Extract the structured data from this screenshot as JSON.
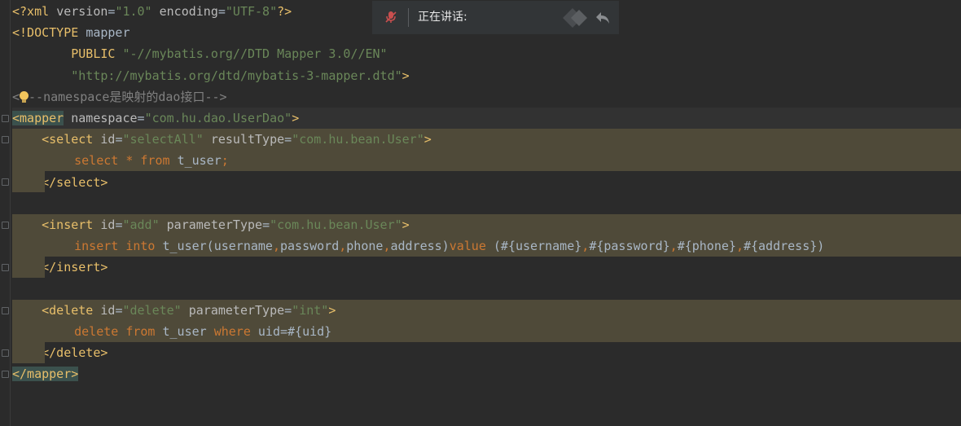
{
  "editor": {
    "lines": [
      {
        "segments": [
          [
            "tag",
            "<?xml "
          ],
          [
            "attr",
            "version"
          ],
          [
            "plain",
            "="
          ],
          [
            "val",
            "\"1.0\""
          ],
          [
            "attr",
            " encoding"
          ],
          [
            "plain",
            "="
          ],
          [
            "val",
            "\"UTF-8\""
          ],
          [
            "tag",
            "?>"
          ]
        ]
      },
      {
        "segments": [
          [
            "tag",
            "<!DOCTYPE "
          ],
          [
            "plain",
            "mapper"
          ]
        ]
      },
      {
        "segments": [
          [
            "plain",
            "        "
          ],
          [
            "tag",
            "PUBLIC "
          ],
          [
            "val",
            "\"-//mybatis.org//DTD Mapper 3.0//EN\""
          ]
        ]
      },
      {
        "segments": [
          [
            "plain",
            "        "
          ],
          [
            "val",
            "\"http://mybatis.org/dtd/mybatis-3-mapper.dtd\""
          ],
          [
            "tag",
            ">"
          ]
        ]
      },
      {
        "segments": [
          [
            "comment",
            "<"
          ],
          [
            "bulb",
            ""
          ],
          [
            "comment",
            "--namespace是映射的dao接口-->"
          ]
        ]
      },
      {
        "segments": [
          [
            "mtag",
            "<mapper"
          ],
          [
            "attr",
            " namespace"
          ],
          [
            "plain",
            "="
          ],
          [
            "val",
            "\"com.hu.dao.UserDao\""
          ],
          [
            "tag",
            ">"
          ]
        ]
      },
      {
        "segments": [
          [
            "plain",
            "    "
          ],
          [
            "tag",
            "<select "
          ],
          [
            "attr",
            "id"
          ],
          [
            "plain",
            "="
          ],
          [
            "val",
            "\"selectAll\""
          ],
          [
            "attr",
            " resultType"
          ],
          [
            "plain",
            "="
          ],
          [
            "val",
            "\"com.hu.bean.User\""
          ],
          [
            "tag",
            ">"
          ]
        ]
      },
      {
        "segments": [
          [
            "plain",
            "        "
          ],
          [
            "kw",
            "select "
          ],
          [
            "kw",
            "* "
          ],
          [
            "kw",
            "from "
          ],
          [
            "plain",
            "t_user"
          ],
          [
            "kw",
            ";"
          ]
        ]
      },
      {
        "segments": [
          [
            "plain",
            "    "
          ],
          [
            "tag",
            "</select>"
          ]
        ]
      },
      {
        "segments": []
      },
      {
        "segments": [
          [
            "plain",
            "    "
          ],
          [
            "tag",
            "<insert "
          ],
          [
            "attr",
            "id"
          ],
          [
            "plain",
            "="
          ],
          [
            "val",
            "\"add\""
          ],
          [
            "attr",
            " parameterType"
          ],
          [
            "plain",
            "="
          ],
          [
            "val",
            "\"com.hu.bean.User\""
          ],
          [
            "tag",
            ">"
          ]
        ]
      },
      {
        "segments": [
          [
            "plain",
            "        "
          ],
          [
            "kw",
            "insert "
          ],
          [
            "kw",
            "into "
          ],
          [
            "plain",
            "t_user(username"
          ],
          [
            "kw",
            ","
          ],
          [
            "plain",
            "password"
          ],
          [
            "kw",
            ","
          ],
          [
            "plain",
            "phone"
          ],
          [
            "kw",
            ","
          ],
          [
            "plain",
            "address)"
          ],
          [
            "kw",
            "value "
          ],
          [
            "plain",
            "(#{username}"
          ],
          [
            "kw",
            ","
          ],
          [
            "plain",
            "#{password}"
          ],
          [
            "kw",
            ","
          ],
          [
            "plain",
            "#{phone}"
          ],
          [
            "kw",
            ","
          ],
          [
            "plain",
            "#{address})"
          ]
        ]
      },
      {
        "segments": [
          [
            "plain",
            "    "
          ],
          [
            "tag",
            "</insert>"
          ]
        ]
      },
      {
        "segments": []
      },
      {
        "segments": [
          [
            "plain",
            "    "
          ],
          [
            "tag",
            "<delete "
          ],
          [
            "attr",
            "id"
          ],
          [
            "plain",
            "="
          ],
          [
            "val",
            "\"delete\""
          ],
          [
            "attr",
            " parameterType"
          ],
          [
            "plain",
            "="
          ],
          [
            "val",
            "\"int\""
          ],
          [
            "tag",
            ">"
          ]
        ]
      },
      {
        "segments": [
          [
            "plain",
            "        "
          ],
          [
            "kw",
            "delete "
          ],
          [
            "kw",
            "from "
          ],
          [
            "plain",
            "t_user "
          ],
          [
            "kw",
            "where "
          ],
          [
            "plain",
            "uid=#{uid}"
          ]
        ]
      },
      {
        "segments": [
          [
            "plain",
            "    "
          ],
          [
            "tag",
            "</delete>"
          ]
        ]
      },
      {
        "segments": [
          [
            "mtag",
            "</mapper>"
          ]
        ]
      }
    ]
  },
  "voice_overlay": {
    "status_label": "正在讲话:",
    "mic_icon": "mic-muted-icon",
    "back_icon": "reply-arrow-icon"
  },
  "colors": {
    "background": "#2b2b2b",
    "tag": "#e8bf6a",
    "attribute": "#bababa",
    "string": "#6a8759",
    "keyword": "#cc7832",
    "text": "#a9b7c6",
    "comment": "#808080",
    "highlight": "#4f4a39"
  }
}
